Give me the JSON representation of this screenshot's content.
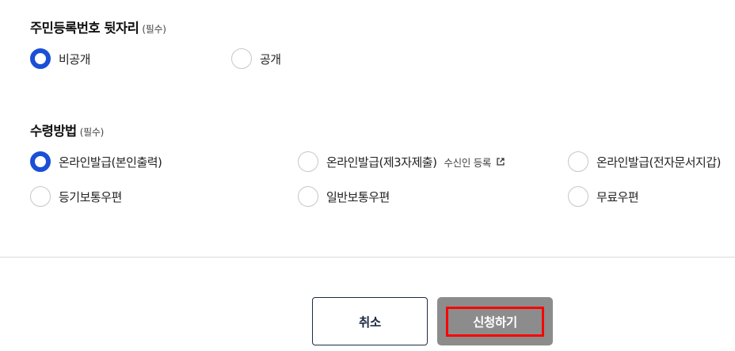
{
  "rrn_section": {
    "title": "주민등록번호 뒷자리",
    "required": "(필수)",
    "options": [
      {
        "label": "비공개",
        "checked": true
      },
      {
        "label": "공개",
        "checked": false
      }
    ]
  },
  "receipt_section": {
    "title": "수령방법",
    "required": "(필수)",
    "options": [
      {
        "label": "온라인발급(본인출력)",
        "checked": true
      },
      {
        "label": "온라인발급(제3자제출)",
        "checked": false
      },
      {
        "label": "온라인발급(전자문서지갑)",
        "checked": false
      },
      {
        "label": "등기보통우편",
        "checked": false
      },
      {
        "label": "일반보통우편",
        "checked": false
      },
      {
        "label": "무료우편",
        "checked": false
      }
    ],
    "recipient_link": "수신인 등록",
    "recipient_link_icon": "external-link-icon"
  },
  "actions": {
    "cancel_label": "취소",
    "submit_label": "신청하기"
  },
  "colors": {
    "accent": "#1a4fd6",
    "submit_bg": "#8c8c8c",
    "highlight": "#ff0000",
    "cancel_border": "#1e2a44"
  }
}
